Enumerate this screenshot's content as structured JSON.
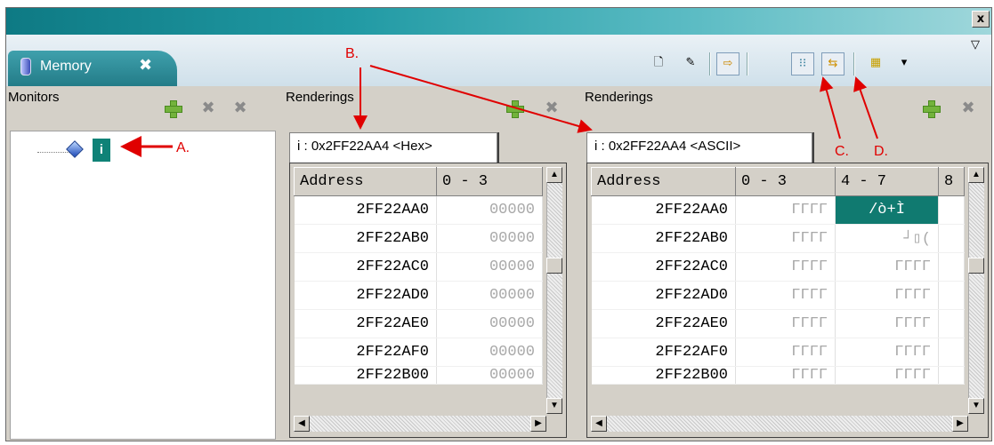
{
  "view": {
    "tab_label": "Memory",
    "tab_close": "✖",
    "window_close": "x"
  },
  "panes": {
    "monitors_title": "Monitors",
    "renderings_title_1": "Renderings",
    "renderings_title_2": "Renderings"
  },
  "tree": {
    "item_label": "i"
  },
  "annotations": {
    "a": "A.",
    "b": "B.",
    "c": "C.",
    "d": "D."
  },
  "hex": {
    "tab": "i : 0x2FF22AA4 <Hex>",
    "cols": [
      "Address",
      "0 - 3"
    ],
    "rows": [
      [
        "2FF22AA0",
        "00000"
      ],
      [
        "2FF22AB0",
        "00000"
      ],
      [
        "2FF22AC0",
        "00000"
      ],
      [
        "2FF22AD0",
        "00000"
      ],
      [
        "2FF22AE0",
        "00000"
      ],
      [
        "2FF22AF0",
        "00000"
      ],
      [
        "2FF22B00",
        "00000"
      ]
    ]
  },
  "ascii": {
    "tab": "i : 0x2FF22AA4 <ASCII>",
    "cols": [
      "Address",
      "0 - 3",
      "4 - 7",
      "8"
    ],
    "rows": [
      [
        "2FF22AA0",
        "ΓΓΓΓ",
        "/ò+Ì"
      ],
      [
        "2FF22AB0",
        "ΓΓΓΓ",
        "┘▯("
      ],
      [
        "2FF22AC0",
        "ΓΓΓΓ",
        "ΓΓΓΓ"
      ],
      [
        "2FF22AD0",
        "ΓΓΓΓ",
        "ΓΓΓΓ"
      ],
      [
        "2FF22AE0",
        "ΓΓΓΓ",
        "ΓΓΓΓ"
      ],
      [
        "2FF22AF0",
        "ΓΓΓΓ",
        "ΓΓΓΓ"
      ],
      [
        "2FF22B00",
        "ΓΓΓΓ",
        "ΓΓΓΓ"
      ]
    ]
  },
  "colors": {
    "accent": "#0f8277",
    "annotation": "#e00000"
  }
}
